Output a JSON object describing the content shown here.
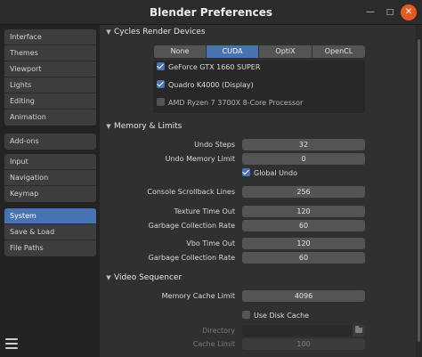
{
  "window": {
    "title": "Blender Preferences",
    "minimize_glyph": "—",
    "maximize_glyph": "□",
    "close_glyph": "✕"
  },
  "sidebar": {
    "groups": [
      {
        "items": [
          {
            "label": "Interface",
            "active": false
          },
          {
            "label": "Themes",
            "active": false
          },
          {
            "label": "Viewport",
            "active": false
          },
          {
            "label": "Lights",
            "active": false
          },
          {
            "label": "Editing",
            "active": false
          },
          {
            "label": "Animation",
            "active": false
          }
        ]
      },
      {
        "items": [
          {
            "label": "Add-ons",
            "active": false
          }
        ]
      },
      {
        "items": [
          {
            "label": "Input",
            "active": false
          },
          {
            "label": "Navigation",
            "active": false
          },
          {
            "label": "Keymap",
            "active": false
          }
        ]
      },
      {
        "items": [
          {
            "label": "System",
            "active": true
          },
          {
            "label": "Save & Load",
            "active": false
          },
          {
            "label": "File Paths",
            "active": false
          }
        ]
      }
    ],
    "menu_icon": "hamburger-menu-icon"
  },
  "cycles": {
    "header": "Cycles Render Devices",
    "tabs": [
      {
        "label": "None",
        "active": false
      },
      {
        "label": "CUDA",
        "active": true
      },
      {
        "label": "OptiX",
        "active": false
      },
      {
        "label": "OpenCL",
        "active": false
      }
    ],
    "devices": [
      {
        "label": "GeForce GTX 1660 SUPER",
        "checked": true
      },
      {
        "label": "Quadro K4000 (Display)",
        "checked": true
      },
      {
        "label": "AMD Ryzen 7 3700X 8-Core Processor",
        "checked": false
      }
    ]
  },
  "memory": {
    "header": "Memory & Limits",
    "undo_steps_label": "Undo Steps",
    "undo_steps": "32",
    "undo_memory_label": "Undo Memory Limit",
    "undo_memory": "0",
    "global_undo_label": "Global Undo",
    "global_undo": true,
    "scrollback_label": "Console Scrollback Lines",
    "scrollback": "256",
    "texture_timeout_label": "Texture Time Out",
    "texture_timeout": "120",
    "texture_gc_label": "Garbage Collection Rate",
    "texture_gc": "60",
    "vbo_timeout_label": "Vbo Time Out",
    "vbo_timeout": "120",
    "vbo_gc_label": "Garbage Collection Rate",
    "vbo_gc": "60"
  },
  "sequencer": {
    "header": "Video Sequencer",
    "memory_cache_label": "Memory Cache Limit",
    "memory_cache": "4096",
    "use_disk_cache_label": "Use Disk Cache",
    "use_disk_cache": false,
    "directory_label": "Directory",
    "directory_value": "",
    "cache_limit_label": "Cache Limit",
    "cache_limit": "100",
    "folder_icon": "folder-icon"
  },
  "colors": {
    "accent": "#4772b3",
    "close_button": "#e35b24",
    "background": "#303030",
    "sidebar": "#232323"
  }
}
